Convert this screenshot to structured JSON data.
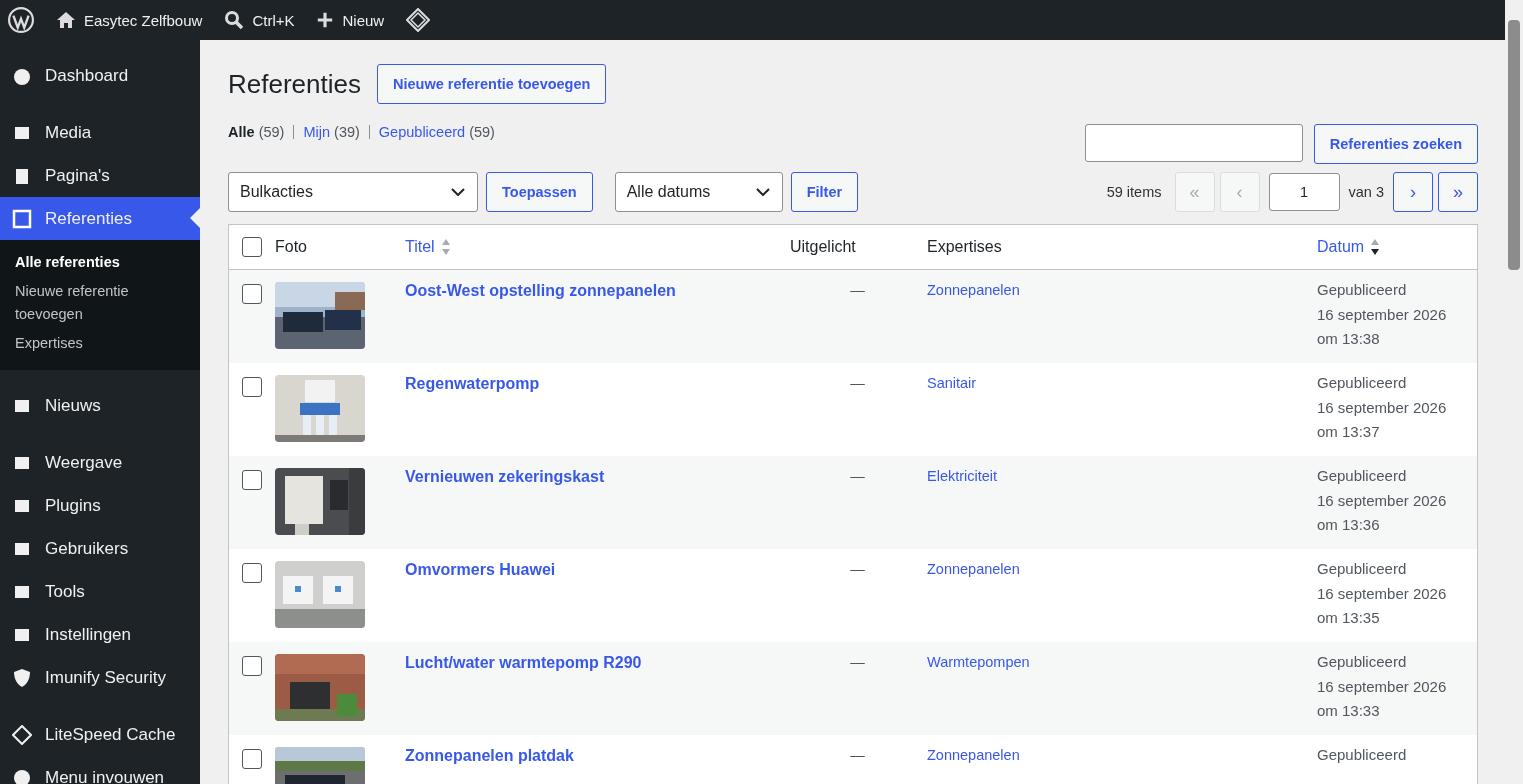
{
  "admin_bar": {
    "site": "Easytec Zelfbouw",
    "search": "Ctrl+K",
    "new": "Nieuw"
  },
  "sidebar": {
    "items": [
      {
        "label": "Dashboard",
        "selected": false
      },
      {
        "label": "Media",
        "selected": false
      },
      {
        "label": "Pagina's",
        "selected": false
      },
      {
        "label": "Referenties",
        "selected": true,
        "children": [
          {
            "label": "Alle referenties",
            "selected": true
          },
          {
            "label": "Nieuwe referentie toevoegen",
            "selected": false
          },
          {
            "label": "Expertises",
            "selected": false
          }
        ]
      },
      {
        "label": "Nieuws",
        "selected": false
      },
      {
        "label": "Weergave",
        "selected": false
      },
      {
        "label": "Plugins",
        "selected": false
      },
      {
        "label": "Gebruikers",
        "selected": false
      },
      {
        "label": "Tools",
        "selected": false
      },
      {
        "label": "Instellingen",
        "selected": false
      },
      {
        "label": "Imunify Security",
        "selected": false
      },
      {
        "label": "LiteSpeed Cache",
        "selected": false
      },
      {
        "label": "Menu invouwen",
        "selected": false
      }
    ]
  },
  "page": {
    "title": "Referenties",
    "add_button": "Nieuwe referentie toevoegen"
  },
  "views": [
    {
      "label": "Alle",
      "count": "(59)",
      "selected": true
    },
    {
      "label": "Mijn",
      "count": "(39)",
      "selected": false
    },
    {
      "label": "Gepubliceerd",
      "count": "(59)",
      "selected": false
    }
  ],
  "search": {
    "button": "Referenties zoeken"
  },
  "bulk": {
    "value": "Bulkacties",
    "button": "Toepassen"
  },
  "dates": {
    "value": "Alle datums",
    "button": "Filter"
  },
  "pagination": {
    "items": "59 items",
    "first": "«",
    "prev": "‹",
    "page": "1",
    "of": "van 3",
    "next": "›",
    "last": "»"
  },
  "table": {
    "columns": [
      {
        "label": "Foto",
        "kind": "plain"
      },
      {
        "label": "Titel",
        "kind": "sortable",
        "sorted_desc": false
      },
      {
        "label": "Uitgelicht",
        "kind": "plain"
      },
      {
        "label": "Expertises",
        "kind": "plain"
      },
      {
        "label": "Datum",
        "kind": "sortable",
        "sorted_desc": true
      }
    ],
    "select_all_checked": false,
    "rows": [
      {
        "checked": false,
        "title": "Oost-West opstelling zonnepanelen",
        "featured": "—",
        "expertise": "Zonnepanelen",
        "status": "Gepubliceerd",
        "date": "16 september 2026",
        "time": "om 13:38"
      },
      {
        "checked": false,
        "title": "Regenwaterpomp",
        "featured": "—",
        "expertise": "Sanitair",
        "status": "Gepubliceerd",
        "date": "16 september 2026",
        "time": "om 13:37"
      },
      {
        "checked": false,
        "title": "Vernieuwen zekeringskast",
        "featured": "—",
        "expertise": "Elektriciteit",
        "status": "Gepubliceerd",
        "date": "16 september 2026",
        "time": "om 13:36"
      },
      {
        "checked": false,
        "title": "Omvormers Huawei",
        "featured": "—",
        "expertise": "Zonnepanelen",
        "status": "Gepubliceerd",
        "date": "16 september 2026",
        "time": "om 13:35"
      },
      {
        "checked": false,
        "title": "Lucht/water warmtepomp R290",
        "featured": "—",
        "expertise": "Warmtepompen",
        "status": "Gepubliceerd",
        "date": "16 september 2026",
        "time": "om 13:33"
      },
      {
        "checked": false,
        "title": "Zonnepanelen platdak",
        "featured": "—",
        "expertise": "Zonnepanelen",
        "status": "Gepubliceerd"
      }
    ]
  }
}
